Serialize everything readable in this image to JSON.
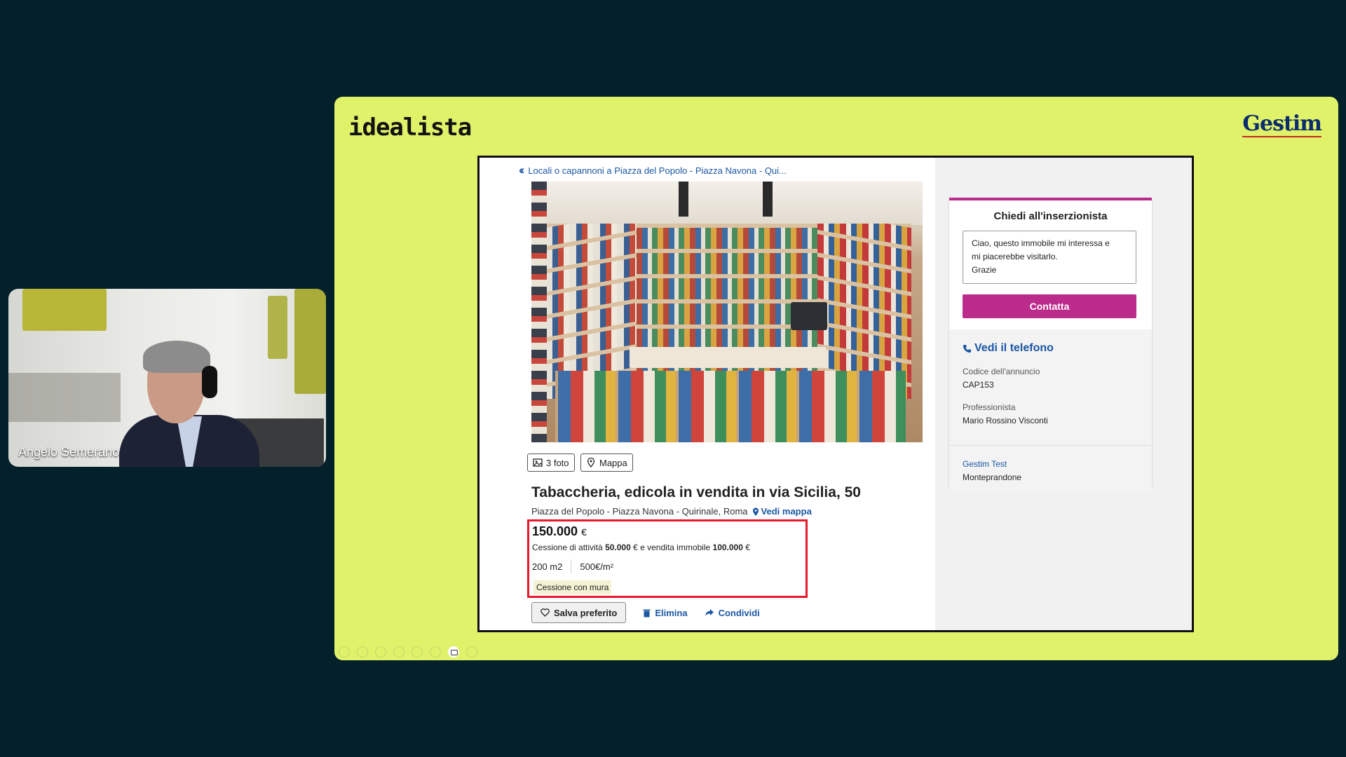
{
  "participant": {
    "name": "Angelo Semerano"
  },
  "slide": {
    "logo_left": "idealista",
    "logo_right": "Gestim"
  },
  "listing": {
    "breadcrumb": "Locali o capannoni a Piazza del Popolo - Piazza Navona - Qui...",
    "photo_count_label": "3 foto",
    "map_label": "Mappa",
    "title": "Tabaccheria, edicola in vendita in via Sicilia, 50",
    "location": "Piazza del Popolo - Piazza Navona - Quirinale, Roma",
    "vedi_mappa": "Vedi mappa",
    "price": "150.000",
    "currency": "€",
    "cessione_prefix": "Cessione di attività",
    "cessione_amount": "50.000",
    "cessione_middle": "€ e vendita immobile",
    "immobile_amount": "100.000",
    "cessione_suffix": "€",
    "area": "200 m2",
    "price_per_m2": "500€/m²",
    "tag": "Cessione con mura",
    "save_label": "Salva preferito",
    "delete_label": "Elimina",
    "share_label": "Condividi"
  },
  "contact": {
    "title": "Chiedi all'inserzionista",
    "message": "Ciao, questo immobile mi interessa e\nmi piacerebbe visitarlo.\nGrazie",
    "button": "Contatta",
    "phone_label": "Vedi il telefono",
    "code_label": "Codice dell'annuncio",
    "code_value": "CAP153",
    "pro_label": "Professionista",
    "pro_value": "Mario Rossino Visconti",
    "agency": "Gestim Test",
    "city": "Monteprandone"
  },
  "colors": {
    "slide_bg": "#dff26a",
    "accent_magenta": "#bb2b8c",
    "link_blue": "#1b57a5",
    "highlight_red": "#e8192c",
    "page_bg": "#04202a"
  }
}
